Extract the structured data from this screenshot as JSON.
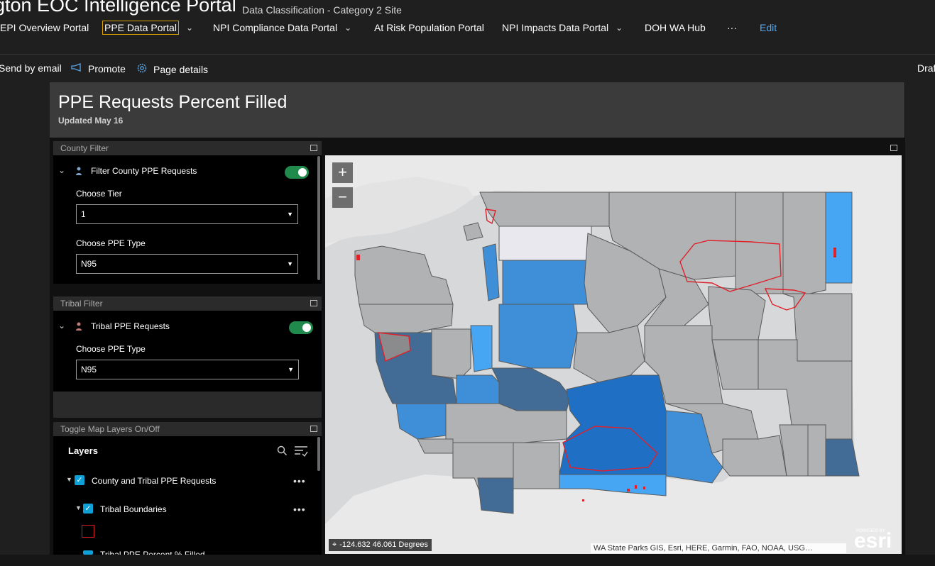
{
  "header": {
    "site_title": "gton EOC Intelligence Portal",
    "classification": "Data Classification - Category 2 Site",
    "nav": [
      {
        "label": "EPI Overview Portal"
      },
      {
        "label": "PPE Data Portal"
      },
      {
        "label": "NPI Compliance Data Portal"
      },
      {
        "label": "At Risk Population Portal"
      },
      {
        "label": "NPI Impacts Data Portal"
      },
      {
        "label": "DOH WA Hub"
      },
      {
        "label": "···"
      },
      {
        "label": "Edit"
      }
    ]
  },
  "command_bar": {
    "send_email": "Send by email",
    "promote": "Promote",
    "page_details": "Page details",
    "status": "Draf"
  },
  "dashboard": {
    "title": "PPE Requests Percent Filled",
    "subtitle": "Updated May 16"
  },
  "county_filter": {
    "header": "County Filter",
    "toggle_label": "Filter County PPE Requests",
    "toggle_on": true,
    "tier_label": "Choose Tier",
    "tier_value": "1",
    "ppe_label": "Choose PPE Type",
    "ppe_value": "N95"
  },
  "tribal_filter": {
    "header": "Tribal Filter",
    "toggle_label": "Tribal PPE Requests",
    "toggle_on": true,
    "ppe_label": "Choose PPE Type",
    "ppe_value": "N95"
  },
  "layers_panel": {
    "header": "Toggle Map Layers On/Off",
    "title": "Layers",
    "layers": [
      {
        "label": "County and Tribal PPE Requests",
        "checked": true
      },
      {
        "label": "Tribal Boundaries",
        "checked": true
      },
      {
        "label": "Tribal PPE Percent % Filled",
        "checked": true
      }
    ]
  },
  "map": {
    "zoom_in": "+",
    "zoom_out": "−",
    "coordinates": "-124.632 46.061 Degrees",
    "attribution": "WA State Parks GIS, Esri, HERE, Garmin, FAO, NOAA, USG…",
    "powered_by": "POWERED BY",
    "logo": "esri",
    "colors": {
      "not_reported": "#b1b2b4",
      "light": "#e8e8ee",
      "mid": "#3f8fd8",
      "bright": "#46a6f4",
      "dark": "#426b96",
      "tribal_outline": "#e0202a",
      "water": "#d7d8d9"
    }
  }
}
